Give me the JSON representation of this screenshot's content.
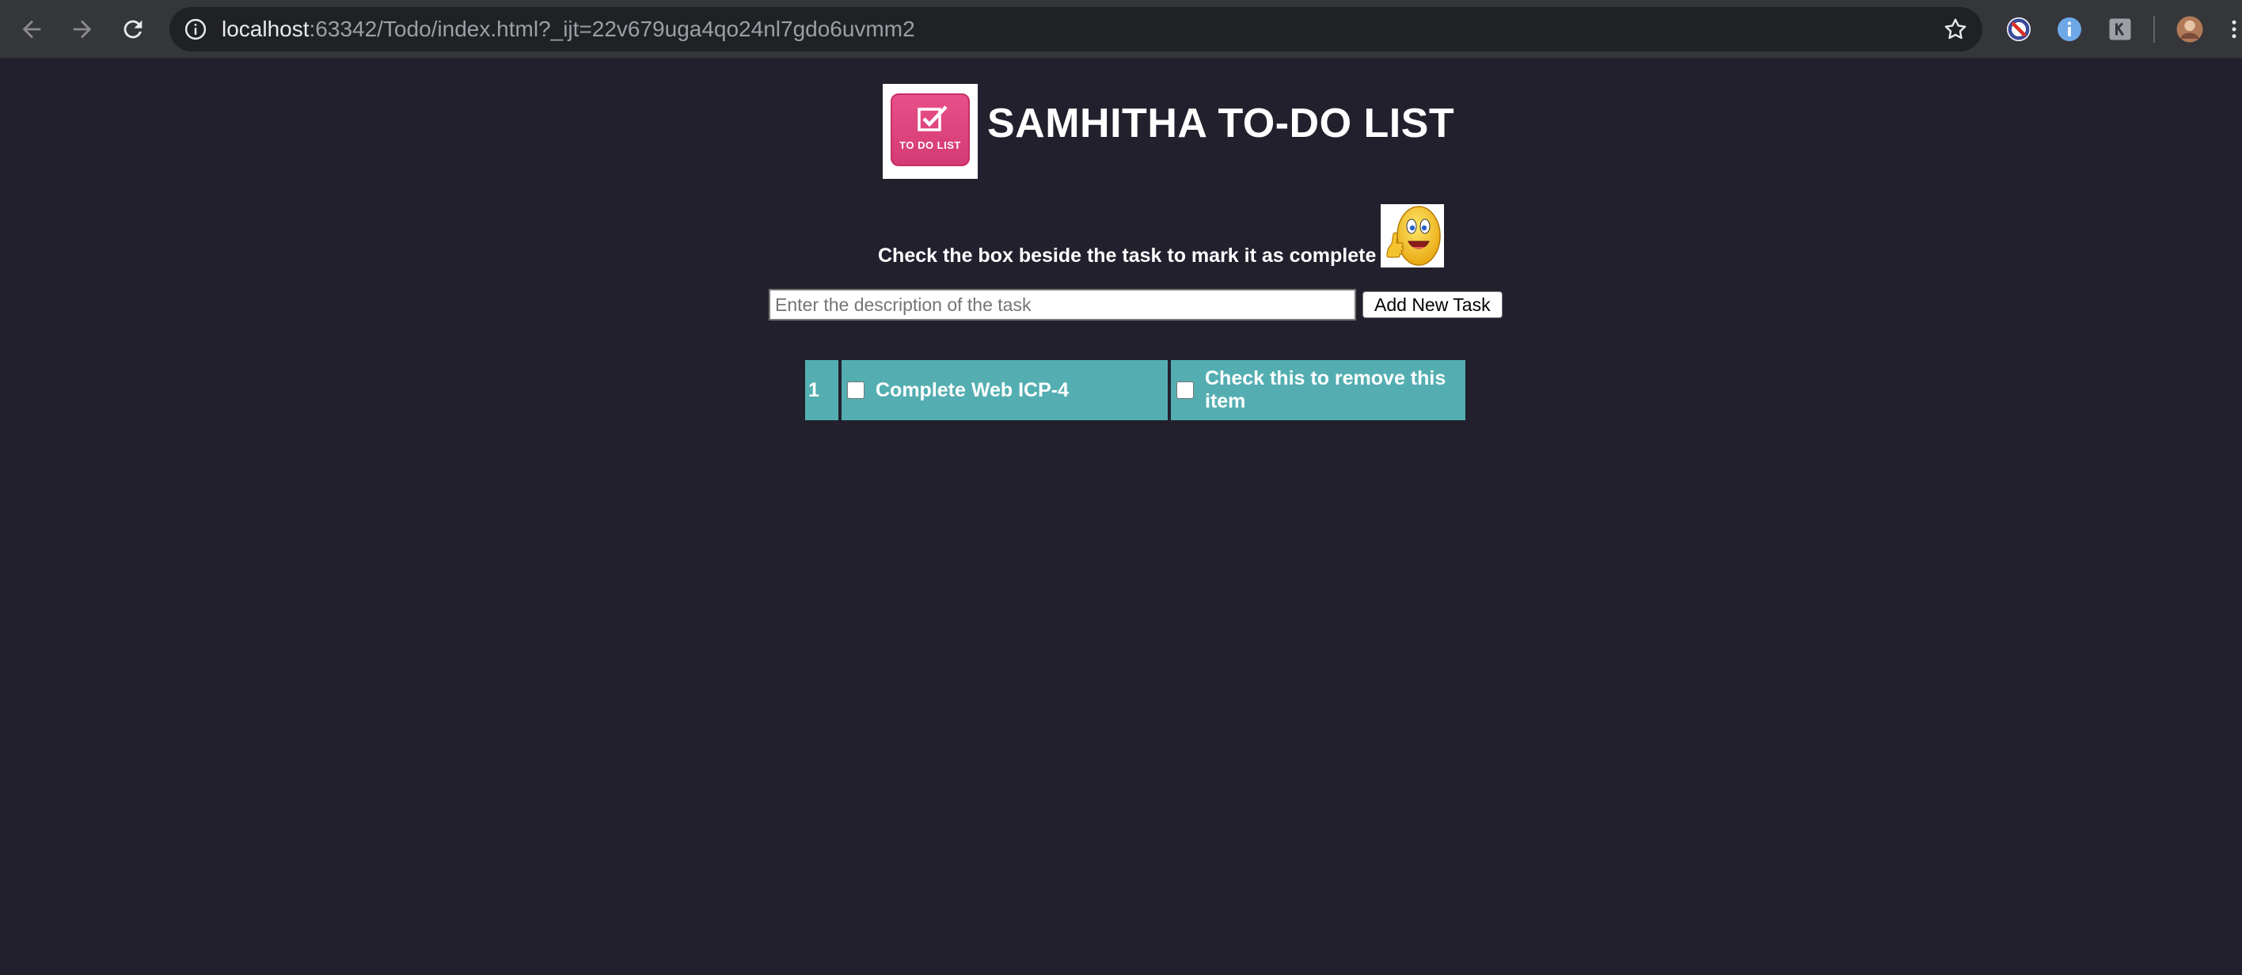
{
  "browser": {
    "url_host": "localhost",
    "url_rest": ":63342/Todo/index.html?_ijt=22v679uga4qo24nl7gdo6uvmm2"
  },
  "header": {
    "logo_text": "TO DO LIST",
    "title": "SAMHITHA TO-DO LIST"
  },
  "instruction": {
    "text": "Check the box beside the task to mark it as complete"
  },
  "add_task": {
    "placeholder": "Enter the description of the task",
    "button_label": "Add New Task"
  },
  "tasks": [
    {
      "number": "1",
      "description": "Complete Web ICP-4",
      "remove_label": "Check this to remove this item"
    }
  ],
  "colors": {
    "background": "#23202e",
    "task_cell": "#54aeb1",
    "logo_pink": "#e8508a"
  },
  "icons": {
    "back": "arrow-left-icon",
    "forward": "arrow-right-icon",
    "reload": "reload-icon",
    "info": "info-icon",
    "bookmark": "star-icon"
  }
}
